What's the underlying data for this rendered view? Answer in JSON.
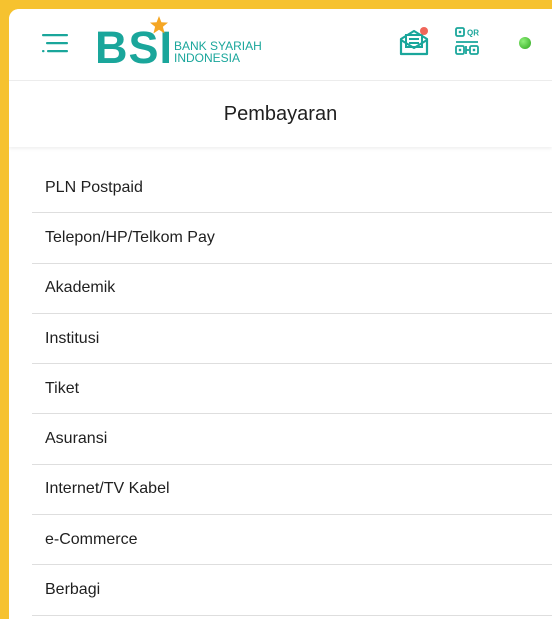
{
  "header": {
    "menu_icon": "hamburger-menu-icon",
    "logo": {
      "brand": "BSI",
      "line1": "BANK SYARIAH",
      "line2": "INDONESIA"
    },
    "inbox_icon": "mail-notification-icon",
    "qr_icon": "qr-code-icon",
    "status_icon": "online-status-dot",
    "colors": {
      "brand_teal": "#1aa69b",
      "star_orange": "#f5a623",
      "notification_red": "#f0665a",
      "status_green": "#3cc22a",
      "frame_yellow": "#f6c22f"
    }
  },
  "page": {
    "title": "Pembayaran"
  },
  "menu": {
    "items": [
      {
        "label": "PLN Postpaid"
      },
      {
        "label": "Telepon/HP/Telkom Pay"
      },
      {
        "label": "Akademik"
      },
      {
        "label": "Institusi"
      },
      {
        "label": "Tiket"
      },
      {
        "label": "Asuransi"
      },
      {
        "label": "Internet/TV Kabel"
      },
      {
        "label": "e-Commerce"
      },
      {
        "label": "Berbagi"
      }
    ]
  }
}
